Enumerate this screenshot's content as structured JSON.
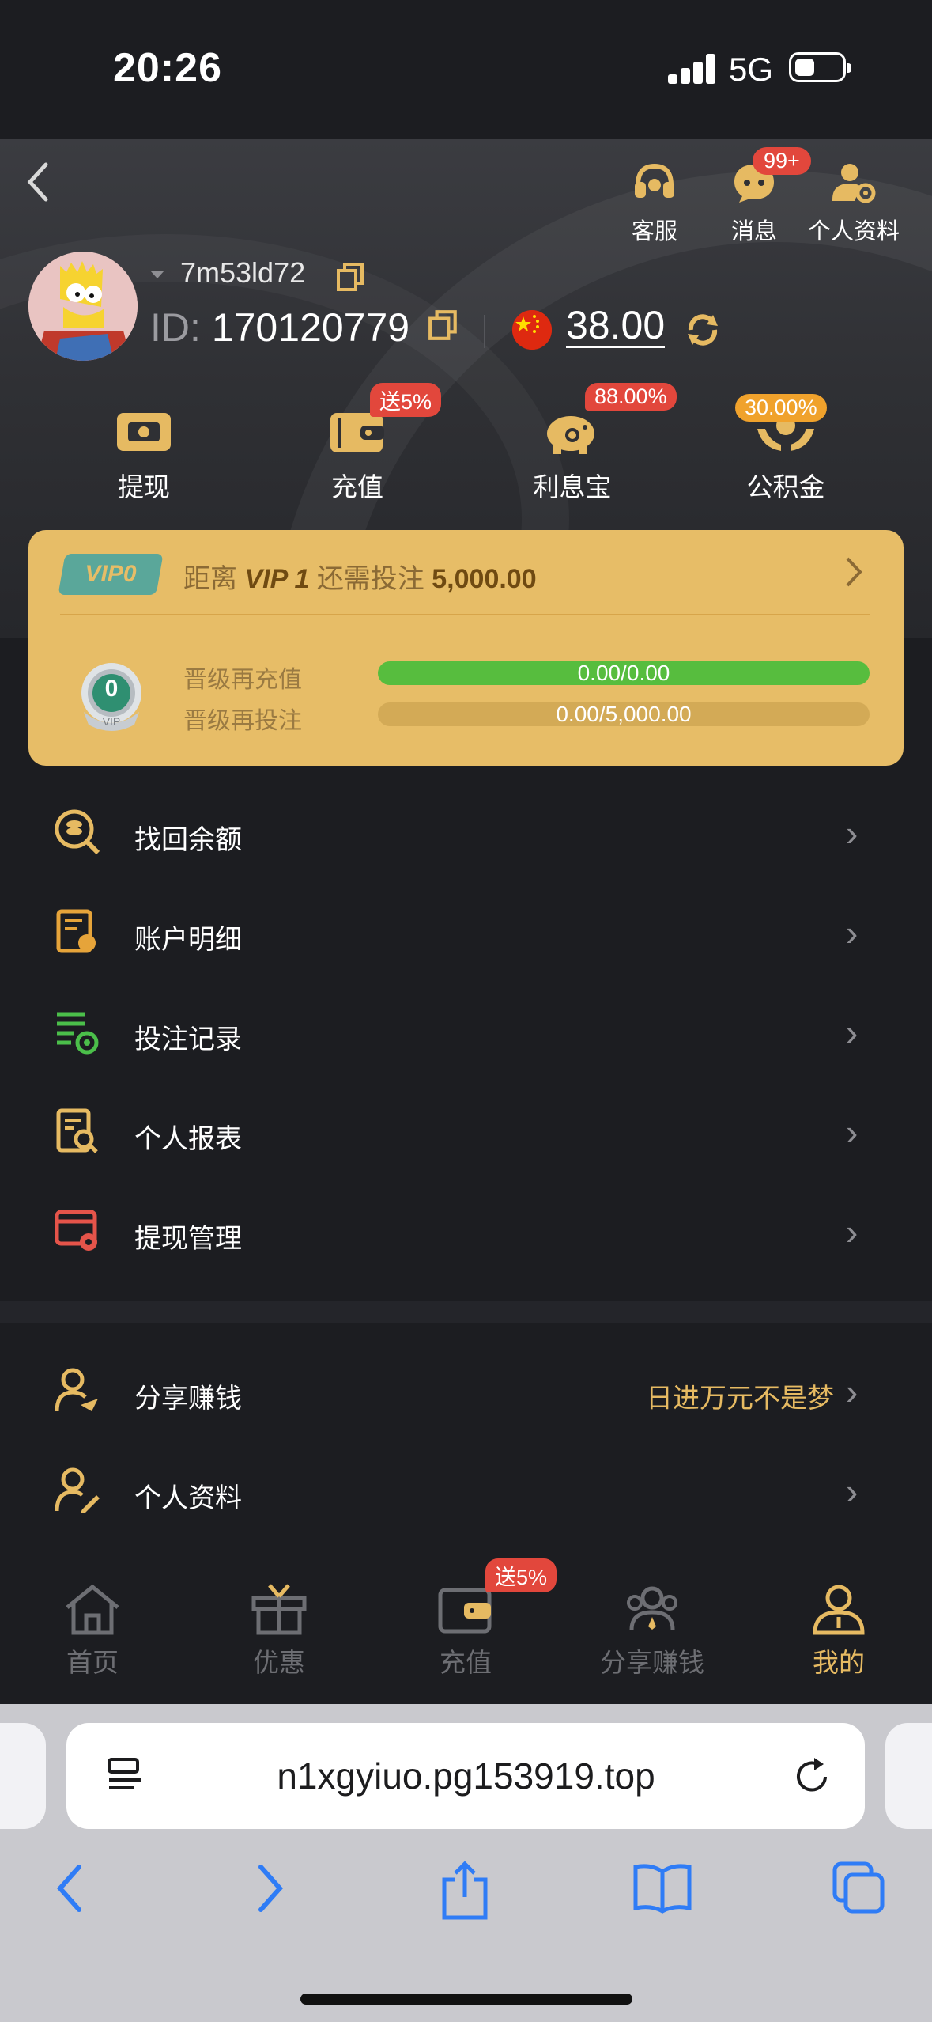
{
  "status_bar": {
    "time": "20:26",
    "network": "5G"
  },
  "header_icons": {
    "service": "客服",
    "messages": "消息",
    "messages_badge": "99+",
    "profile": "个人资料"
  },
  "user": {
    "name": "7m53ld72",
    "id_label": "ID:",
    "id": "170120779",
    "balance": "38.00"
  },
  "actions": [
    {
      "label": "提现",
      "tag": ""
    },
    {
      "label": "充值",
      "tag": "送5%"
    },
    {
      "label": "利息宝",
      "tag": "88.00%"
    },
    {
      "label": "公积金",
      "tag": "30.00%"
    }
  ],
  "vip": {
    "badge": "VIP0",
    "text_prefix": "距离",
    "next_level": "VIP 1",
    "text_mid": "还需投注",
    "amount": "5,000.00",
    "level_num": "0",
    "level_tag": "VIP",
    "rows": [
      {
        "label": "晋级再充值",
        "value": "0.00/0.00",
        "progress": 1.0
      },
      {
        "label": "晋级再投注",
        "value": "0.00/5,000.00",
        "progress": 0.0
      }
    ]
  },
  "menu": [
    {
      "label": "找回余额",
      "icon": "coin-search-icon"
    },
    {
      "label": "账户明细",
      "icon": "account-detail-icon"
    },
    {
      "label": "投注记录",
      "icon": "bet-record-icon"
    },
    {
      "label": "个人报表",
      "icon": "report-search-icon"
    },
    {
      "label": "提现管理",
      "icon": "withdraw-manage-icon"
    }
  ],
  "menu2": [
    {
      "label": "分享赚钱",
      "right": "日进万元不是梦",
      "icon": "share-user-icon"
    },
    {
      "label": "个人资料",
      "right": "",
      "icon": "user-edit-icon"
    }
  ],
  "tabs": [
    {
      "label": "首页"
    },
    {
      "label": "优惠"
    },
    {
      "label": "充值",
      "tag": "送5%"
    },
    {
      "label": "分享赚钱"
    },
    {
      "label": "我的"
    }
  ],
  "browser": {
    "url": "n1xgyiuo.pg153919.top"
  },
  "colors": {
    "gold": "#e6ba62",
    "vip_card": "#e7bd67",
    "progress_green": "#57bd3e",
    "badge_red": "#e2473c"
  }
}
